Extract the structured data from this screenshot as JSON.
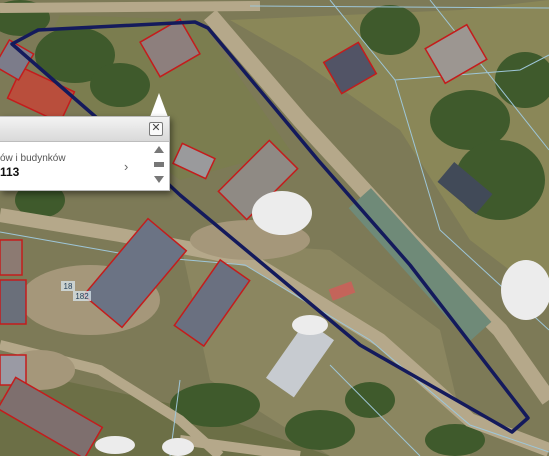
{
  "map": {
    "parcel_outline_color": "#141a5c",
    "building_outline_color": "#c41c1c",
    "boundary_line_color": "#9ec6d8",
    "parcel_labels": [
      "18",
      "182"
    ]
  },
  "popup": {
    "layer_name": "ów i budynków",
    "feature_id": "113",
    "close_label": "✕",
    "next_label": "›",
    "icons": {
      "close": "close-icon",
      "next": "chevron-right-icon",
      "scroll_up": "arrow-up-icon",
      "scroll_down": "arrow-down-icon"
    }
  }
}
